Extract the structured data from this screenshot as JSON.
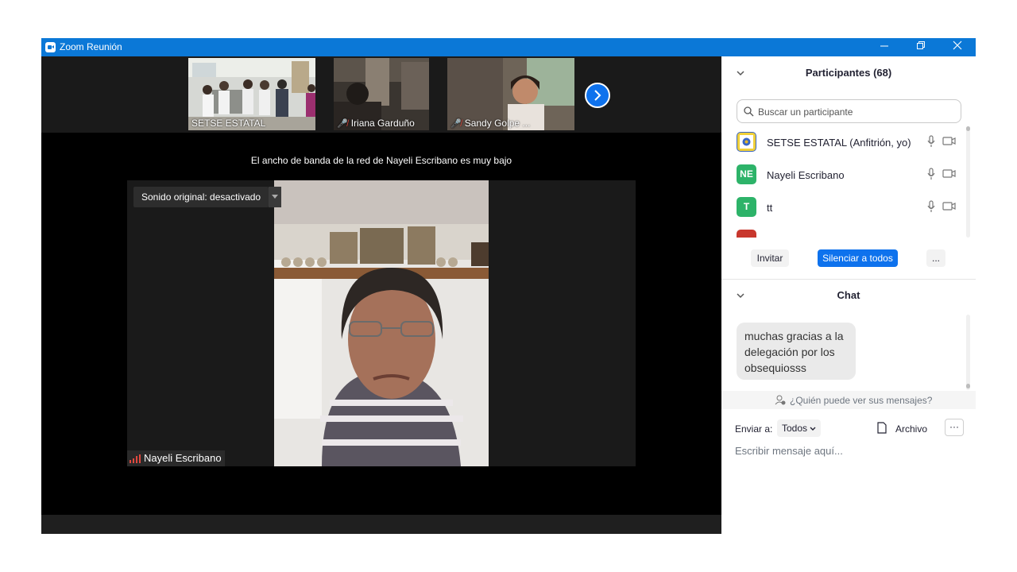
{
  "window": {
    "title": "Zoom Reunión"
  },
  "thumbnails": [
    {
      "name": "SETSE ESTATAL",
      "muted": false
    },
    {
      "name": "Iriana Garduño",
      "muted": true
    },
    {
      "name": "Sandy Golpe ...",
      "muted": true
    }
  ],
  "stage": {
    "bandwidth_notice": "El ancho de banda de la red de Nayeli Escribano es muy bajo",
    "sound_button": "Sonido original: desactivado",
    "speaker_name": "Nayeli Escribano"
  },
  "participants": {
    "header": "Participantes (68)",
    "search_placeholder": "Buscar un participante",
    "items": [
      {
        "name": "SETSE ESTATAL (Anfitrión, yo)",
        "initials": "",
        "color": "#f0d03a"
      },
      {
        "name": "Nayeli Escribano",
        "initials": "NE",
        "color": "#2db369"
      },
      {
        "name": "tt",
        "initials": "T",
        "color": "#2db369"
      }
    ],
    "invite_label": "Invitar",
    "mute_all_label": "Silenciar a todos",
    "more_label": "..."
  },
  "chat": {
    "header": "Chat",
    "message": "muchas gracias a la delegación por los obsequiosss",
    "who_can_see": "¿Quién puede ver sus mensajes?",
    "send_to_label": "Enviar a:",
    "send_to_value": "Todos",
    "file_label": "Archivo",
    "more_label": "···",
    "input_placeholder": "Escribir mensaje aquí..."
  },
  "colors": {
    "accent": "#0e72ed",
    "titlebar": "#0b78d7",
    "muted_red": "#e0483e"
  }
}
